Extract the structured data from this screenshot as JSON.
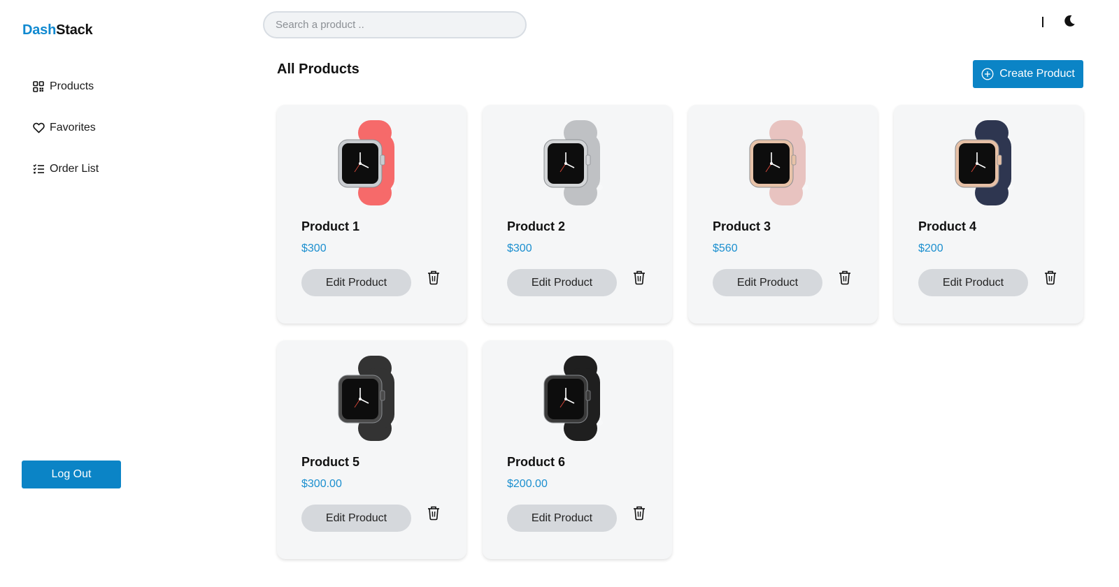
{
  "brand": {
    "part1": "Dash",
    "part2": "Stack"
  },
  "sidebar": {
    "items": [
      {
        "label": "Products",
        "icon": "grid-icon"
      },
      {
        "label": "Favorites",
        "icon": "heart-icon"
      },
      {
        "label": "Order List",
        "icon": "checklist-icon"
      }
    ],
    "logout_label": "Log Out"
  },
  "header": {
    "search_placeholder": "Search a product ..",
    "theme_icon": "moon-icon"
  },
  "main": {
    "title": "All Products",
    "create_label": "Create Product",
    "products": [
      {
        "name": "Product 1",
        "price": "$300",
        "edit_label": "Edit Product",
        "band_color": "#f66a6a",
        "case_color": "#c9ccd0"
      },
      {
        "name": "Product 2",
        "price": "$300",
        "edit_label": "Edit Product",
        "band_color": "#bfc1c4",
        "case_color": "#d4d6d8"
      },
      {
        "name": "Product 3",
        "price": "$560",
        "edit_label": "Edit Product",
        "band_color": "#e8c3c0",
        "case_color": "#e7c2a8"
      },
      {
        "name": "Product 4",
        "price": "$200",
        "edit_label": "Edit Product",
        "band_color": "#2e3650",
        "case_color": "#e6c0a6"
      },
      {
        "name": "Product 5",
        "price": "$300.00",
        "edit_label": "Edit Product",
        "band_color": "#333333",
        "case_color": "#4a4a4a"
      },
      {
        "name": "Product 6",
        "price": "$200.00",
        "edit_label": "Edit Product",
        "band_color": "#1f1f1f",
        "case_color": "#3a3a3a"
      }
    ]
  },
  "colors": {
    "accent": "#0b84c6",
    "price": "#1b8fcf",
    "card_bg": "#f5f6f7"
  }
}
